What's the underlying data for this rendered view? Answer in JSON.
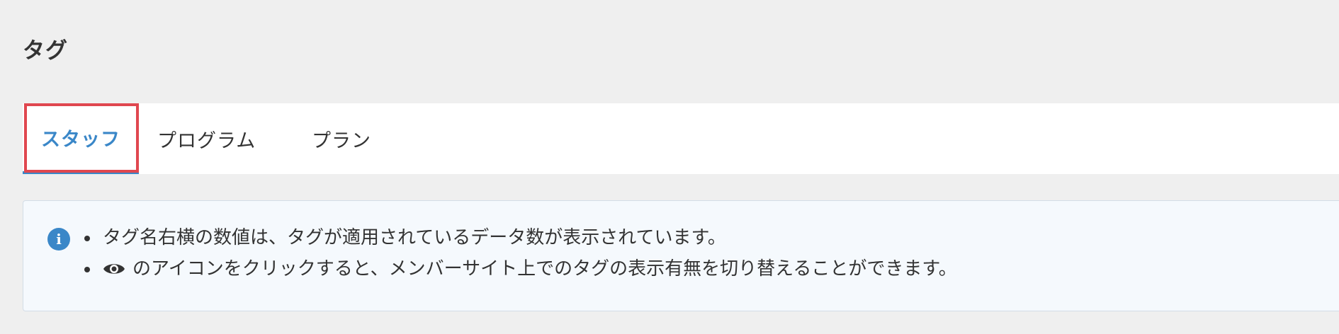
{
  "page": {
    "title": "タグ"
  },
  "tabs": [
    {
      "label": "スタッフ",
      "active": true
    },
    {
      "label": "プログラム",
      "active": false
    },
    {
      "label": "プラン",
      "active": false
    }
  ],
  "notice": {
    "icon": "info-icon",
    "items": [
      {
        "text": "タグ名右横の数値は、タグが適用されているデータ数が表示されています。"
      },
      {
        "icon": "eye-icon",
        "text": "のアイコンをクリックすると、メンバーサイト上でのタグの表示有無を切り替えることができます。"
      }
    ]
  },
  "colors": {
    "accent": "#3a87c8",
    "highlight": "#e0474f",
    "background": "#efefef",
    "notice_background": "#f5f9fd"
  }
}
